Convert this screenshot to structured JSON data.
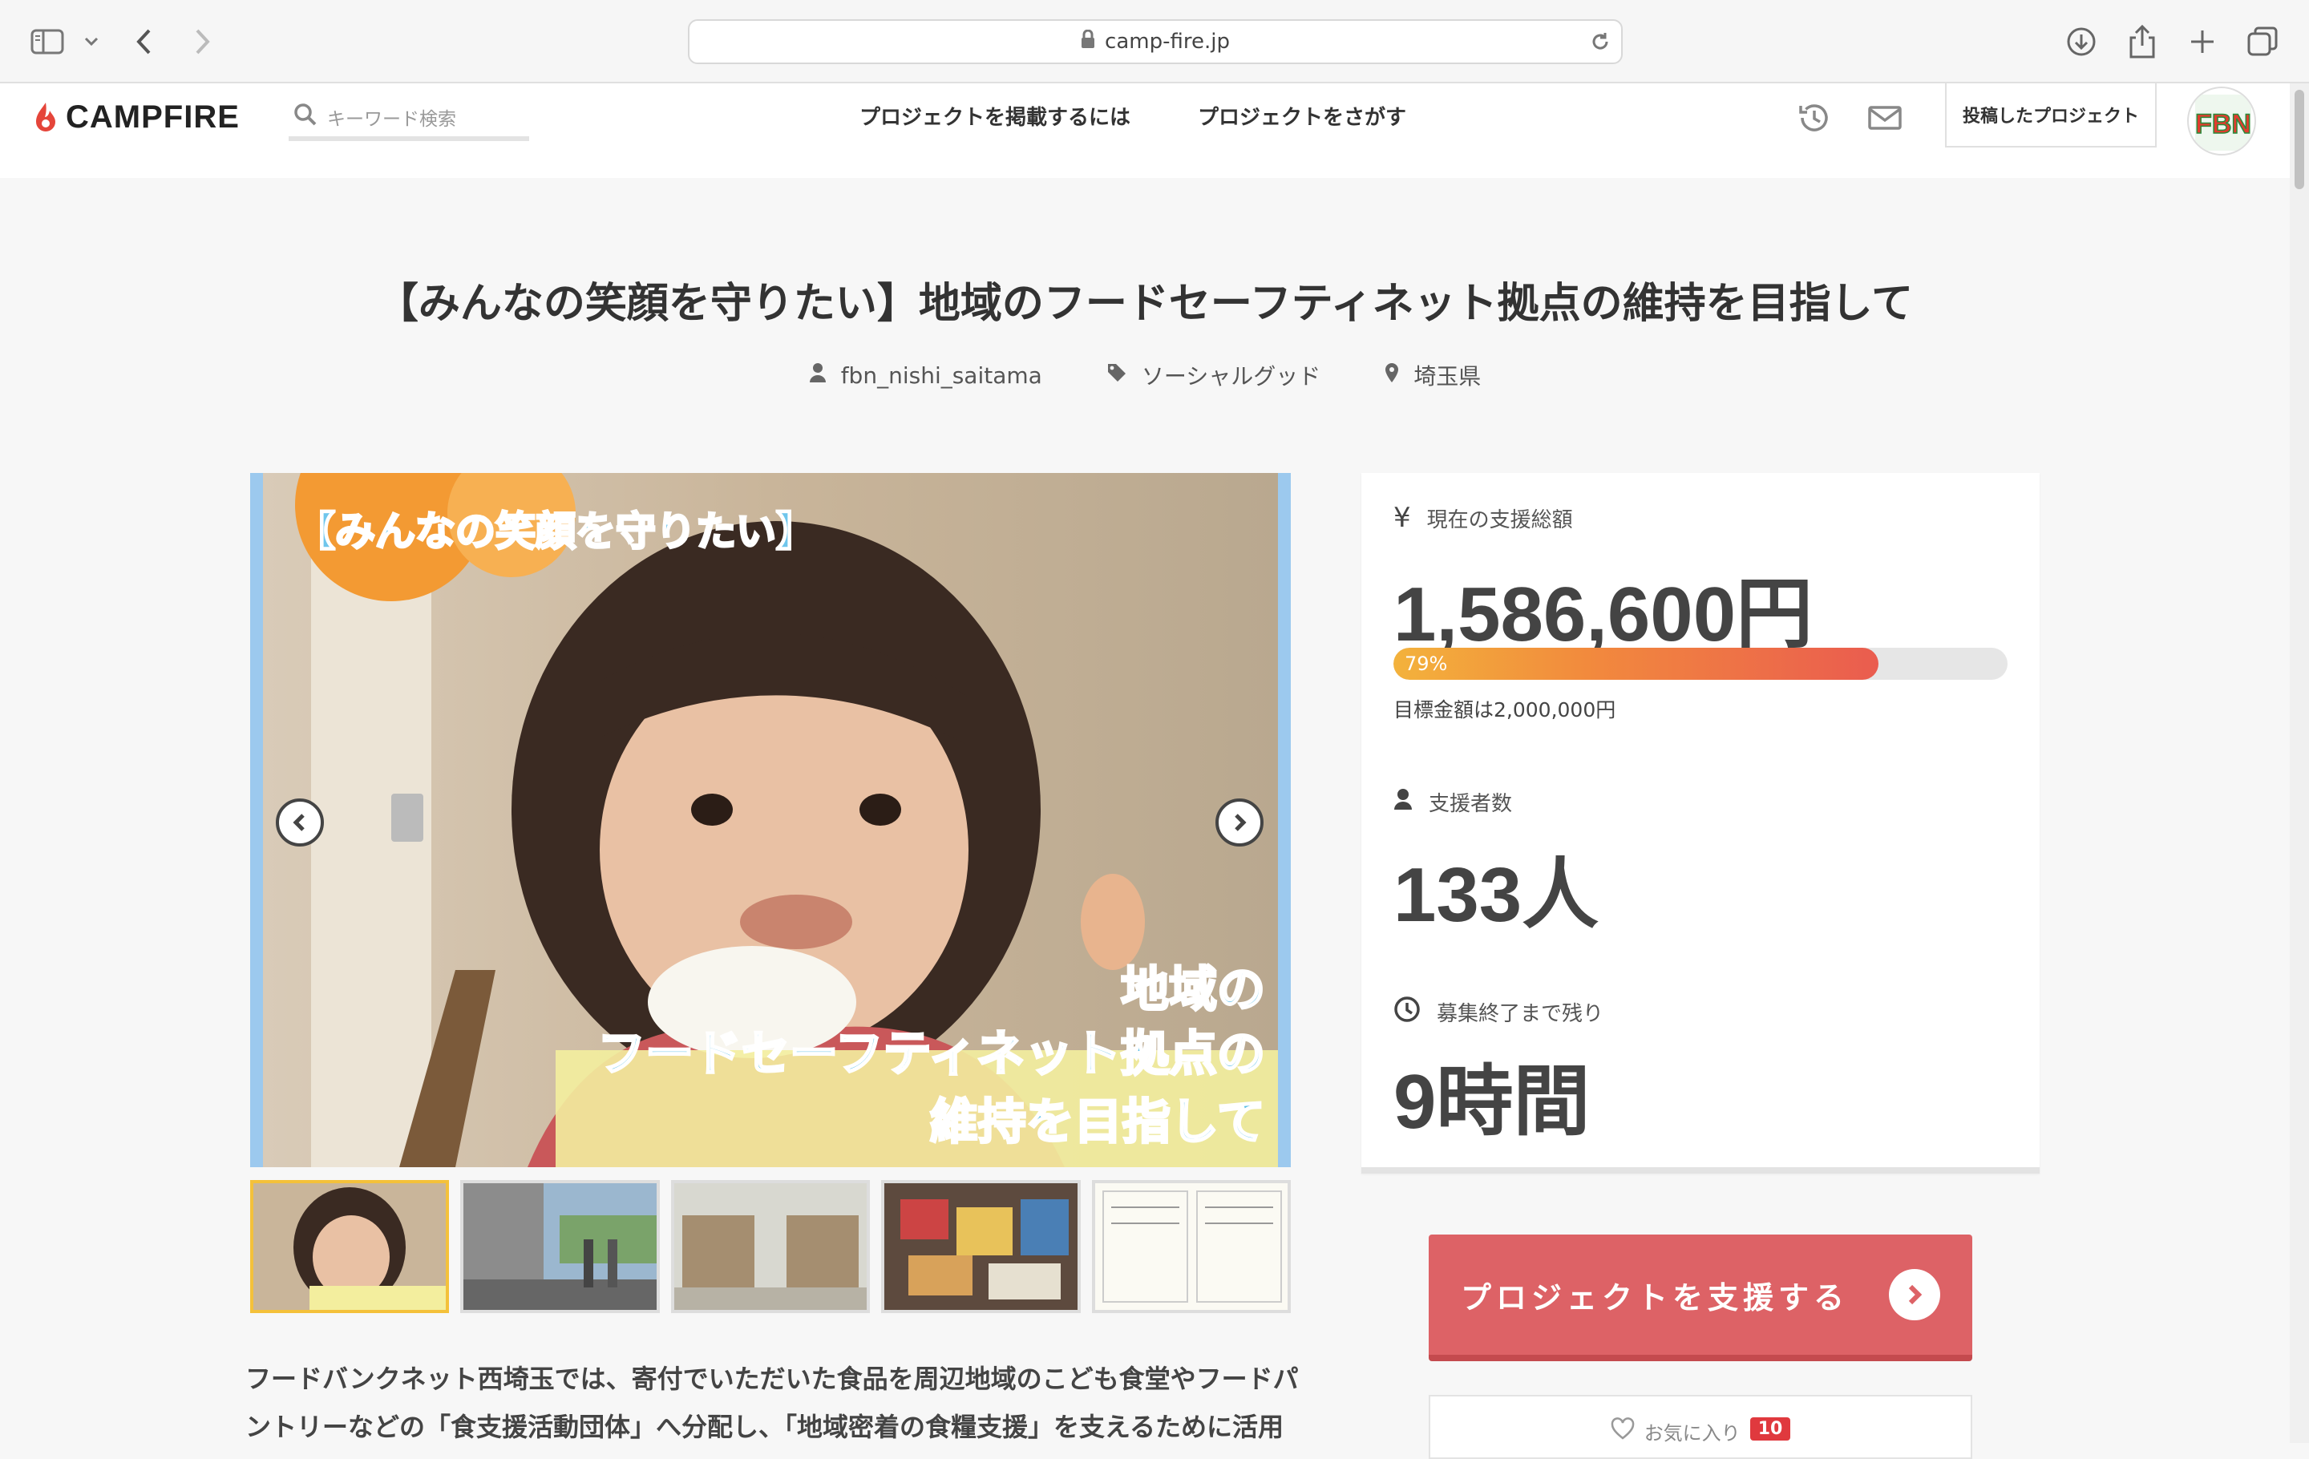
{
  "browser": {
    "url": "camp-fire.jp"
  },
  "header": {
    "logo_text": "CAMPFIRE",
    "search_placeholder": "キーワード検索",
    "nav": [
      "プロジェクトを掲載するには",
      "プロジェクトをさがす"
    ],
    "my_projects_label": "投稿したプロジェクト",
    "avatar_text": "FBN"
  },
  "project": {
    "title": "【みんなの笑顔を守りたい】地域のフードセーフティネット拠点の維持を目指して",
    "owner": "fbn_nishi_saitama",
    "category": "ソーシャルグッド",
    "location": "埼玉県",
    "hero_overlay": {
      "top": "【みんなの笑顔を守りたい】",
      "line1": "地域の",
      "line2": "フードセーフティネット拠点の",
      "line3": "維持を目指して"
    },
    "description": "フードバンクネット西埼玉では、寄付でいただいた食品を周辺地域のこども食堂やフードパントリーなどの「食支援活動団体」へ分配し、「地域密着の食糧支援」を支えるために活用"
  },
  "stats": {
    "total_label": "現在の支援総額",
    "total_value": "1,586,600円",
    "progress_percent": 79,
    "progress_text": "79%",
    "goal_text": "目標金額は2,000,000円",
    "backers_label": "支援者数",
    "backers_value": "133人",
    "remaining_label": "募集終了まで残り",
    "remaining_value": "9時間"
  },
  "actions": {
    "support_label": "プロジェクトを支援する",
    "favorite_label": "お気に入り",
    "favorite_count": "10"
  },
  "colors": {
    "brand_red": "#e5453a",
    "support_button": "#dd6266",
    "progress_start": "#f3b23c",
    "progress_end": "#ea5c4f"
  }
}
